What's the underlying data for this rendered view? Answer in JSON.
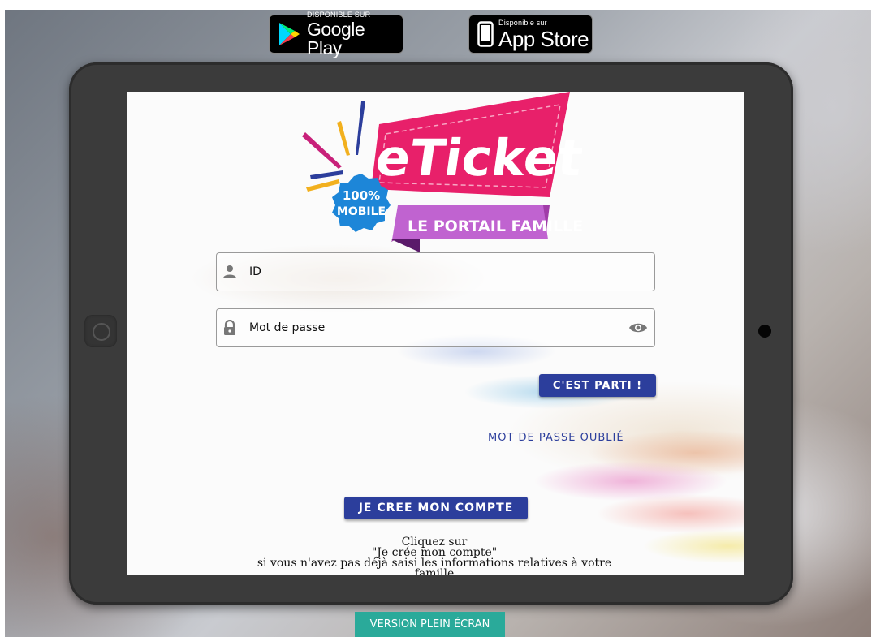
{
  "stores": {
    "google_small": "DISPONIBLE SUR",
    "google_big": "Google Play",
    "apple_small": "Disponible sur",
    "apple_big": "App Store"
  },
  "logo": {
    "title": "eTicket",
    "badge_line1": "100%",
    "badge_line2": "MOBILE",
    "subtitle": "LE PORTAIL FAMILLE"
  },
  "login": {
    "id_placeholder": "ID",
    "password_placeholder": "Mot de passe",
    "submit_label": "C'EST PARTI !",
    "forgot_label": "MOT DE PASSE OUBLIÉ",
    "create_label": "JE CREE MON COMPTE",
    "help_lines": [
      "Cliquez sur",
      "\"Je crée mon compte\"",
      "si vous n'avez pas déjà saisi les informations relatives à votre",
      "famille"
    ]
  },
  "footer": {
    "fullscreen_label": "VERSION PLEIN ÉCRAN"
  },
  "colors": {
    "primary": "#2c3e9c",
    "teal": "#2aaa9a",
    "logo_pink": "#e8206a",
    "logo_purple": "#b84fc8",
    "logo_blue": "#1d86d8"
  },
  "icons": [
    "google-play-icon",
    "apple-icon",
    "person-icon",
    "lock-icon",
    "eye-icon"
  ]
}
